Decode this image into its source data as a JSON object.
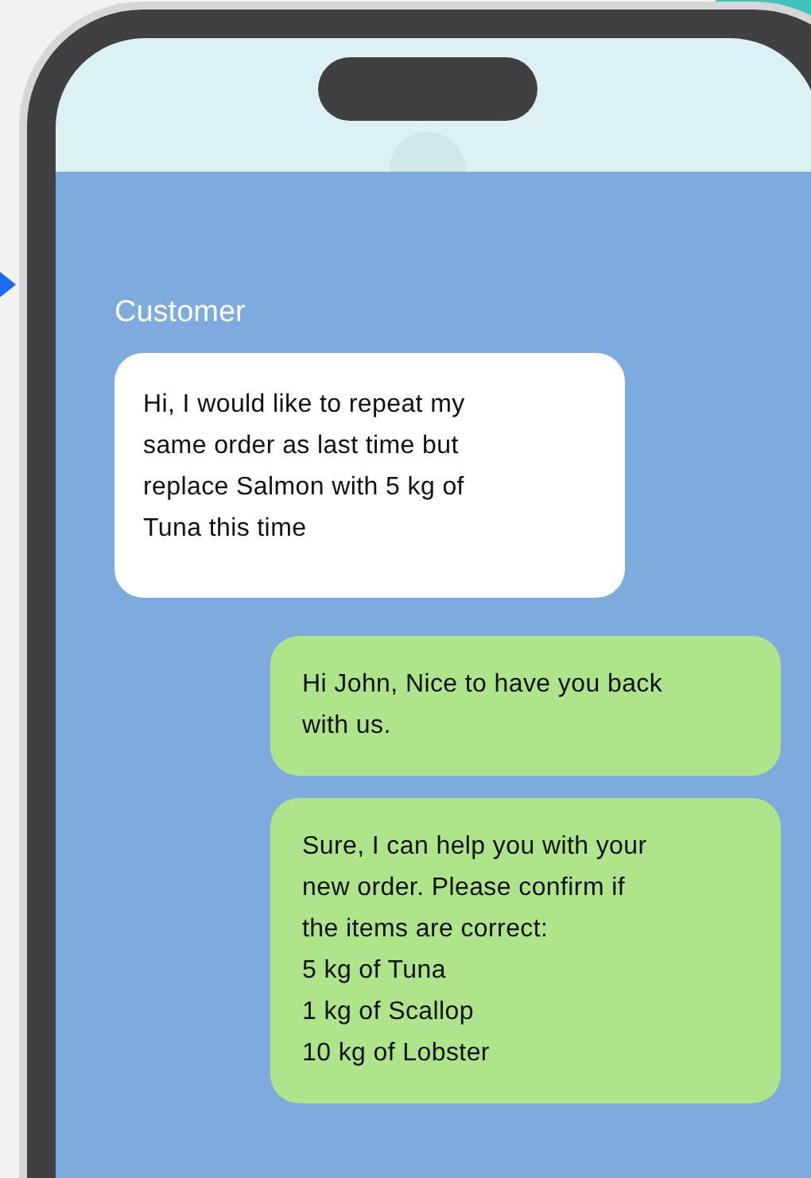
{
  "chat": {
    "sender_label": "Customer",
    "messages": [
      {
        "kind": "customer",
        "text": "Hi, I would like to repeat my\nsame order as last time but\nreplace Salmon with 5 kg of\nTuna this time"
      },
      {
        "kind": "agent",
        "text": "Hi John, Nice to have you back\nwith us."
      },
      {
        "kind": "agent",
        "text": "Sure, I can help you with your\nnew order. Please confirm if\nthe items are correct:\n5 kg of Tuna\n1 kg of Scallop\n10 kg of Lobster"
      }
    ]
  }
}
